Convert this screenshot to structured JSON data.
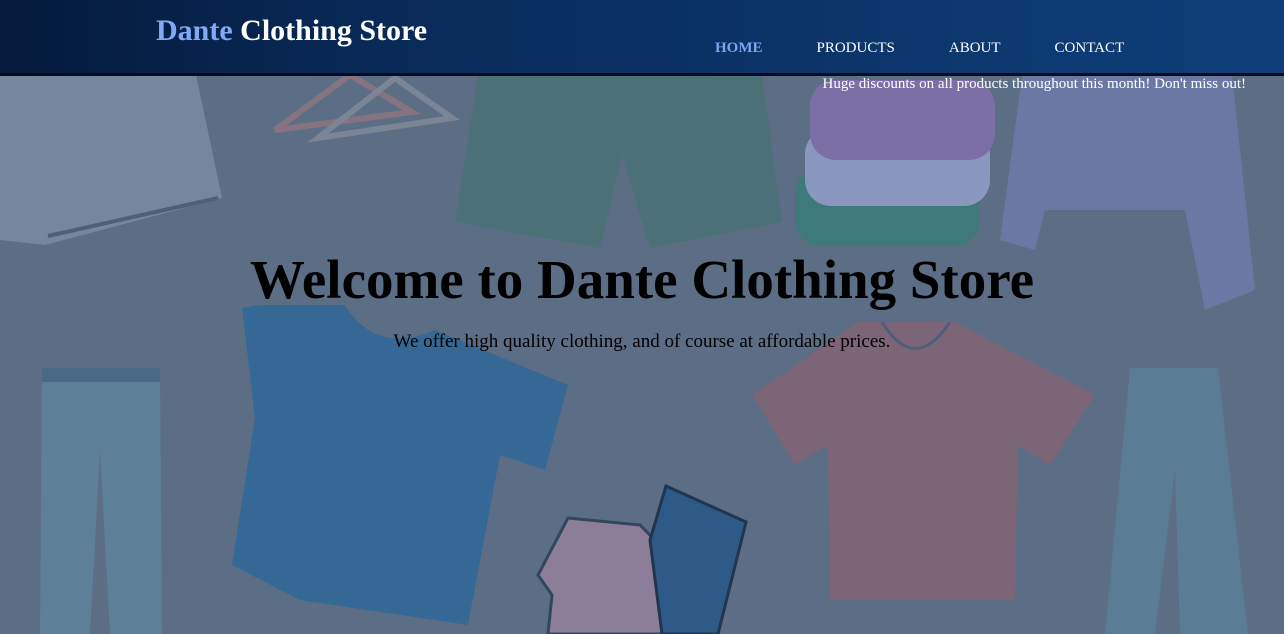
{
  "brand": {
    "accent_word": "Dante",
    "rest": " Clothing Store"
  },
  "nav": [
    {
      "label": "HOME",
      "active": true
    },
    {
      "label": "PRODUCTS",
      "active": false
    },
    {
      "label": "ABOUT",
      "active": false
    },
    {
      "label": "CONTACT",
      "active": false
    }
  ],
  "notice": "Huge discounts on all products throughout this month! Don't miss out!",
  "hero": {
    "title": "Welcome to Dante Clothing Store",
    "subtitle": "We offer high quality clothing, and of course at affordable prices."
  },
  "colors": {
    "header_start": "#041a3c",
    "header_end": "#0e3f7a",
    "accent": "#7fa8f5",
    "background": "#5b6e86"
  },
  "background_items": [
    "hanger",
    "shirt-folded",
    "shorts",
    "sweater-stack",
    "cardigan",
    "jeans",
    "tshirt-blue",
    "tshirt-pink",
    "polo-shirt",
    "jeans-folded"
  ]
}
